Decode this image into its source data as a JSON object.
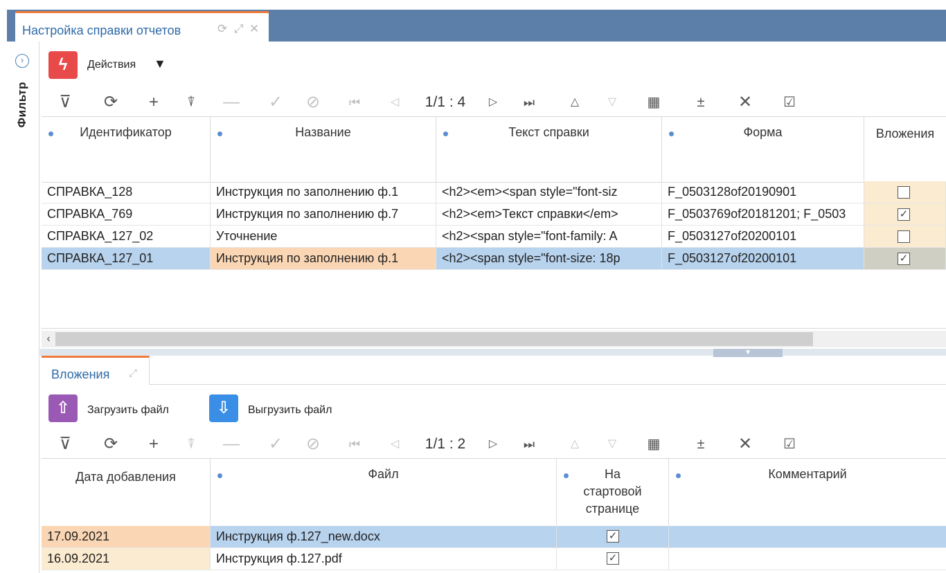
{
  "window": {
    "tab_title": "Настройка справки отчетов",
    "tab_icons": [
      "refresh-icon",
      "expand-icon",
      "close-icon"
    ]
  },
  "filter_panel": {
    "label": "Фильтр"
  },
  "actions": {
    "label": "Действия",
    "dropdown_icon": "triangle-down-icon"
  },
  "main_toolbar": {
    "pager": "1/1 : 4",
    "icons": [
      "filter-icon",
      "refresh-icon",
      "add-icon",
      "edit-icon",
      "remove-icon",
      "confirm-icon",
      "cancel-icon",
      "first-page-icon",
      "prev-page-icon",
      "next-page-icon",
      "last-page-icon",
      "sort-asc-icon",
      "sort-desc-icon",
      "grid-icon",
      "add-column-icon",
      "clear-icon",
      "check-all-icon"
    ]
  },
  "main_grid": {
    "columns": [
      "Идентификатор",
      "Название",
      "Текст справки",
      "Форма",
      "Вложения"
    ],
    "rows": [
      {
        "id": "СПРАВКА_128",
        "name": "Инструкция по заполнению ф.1",
        "text": "<h2><em><span style=\"font-siz",
        "form": "F_0503128of20190901",
        "attach": false
      },
      {
        "id": "СПРАВКА_769",
        "name": "Инструкция по заполнению ф.7",
        "text": "<h2><em>Текст справки</em>",
        "form": "F_0503769of20181201; F_0503",
        "attach": true
      },
      {
        "id": "СПРАВКА_127_02",
        "name": "Уточнение",
        "text": "<h2><span style=\"font-family: A",
        "form": "F_0503127of20200101",
        "attach": false
      },
      {
        "id": "СПРАВКА_127_01",
        "name": "Инструкция по заполнению ф.1",
        "text": "<h2><span style=\"font-size: 18p",
        "form": "F_0503127of20200101",
        "attach": true
      }
    ],
    "selected_row": 3
  },
  "attachments_tab": {
    "label": "Вложения"
  },
  "attachment_actions": {
    "upload_label": "Загрузить файл",
    "download_label": "Выгрузить файл"
  },
  "sub_toolbar": {
    "pager": "1/1 : 2"
  },
  "sub_grid": {
    "columns": [
      "Дата добавления",
      "Файл",
      "На стартовой странице",
      "Комментарий"
    ],
    "column_lines": {
      "start_page": [
        "На",
        "стартовой",
        "странице"
      ]
    },
    "rows": [
      {
        "date": "17.09.2021",
        "file": "Инструкция ф.127_new.docx",
        "on_start": true,
        "comment": ""
      },
      {
        "date": "16.09.2021",
        "file": "Инструкция ф.127.pdf",
        "on_start": true,
        "comment": ""
      }
    ]
  },
  "colors": {
    "accent_tab": "#f07a3a",
    "header_bar": "#5b7fa8",
    "selection": "#b8d3ee",
    "actions_red": "#e84a4a",
    "upload_purple": "#9b59b6",
    "download_blue": "#3a8ee6"
  }
}
